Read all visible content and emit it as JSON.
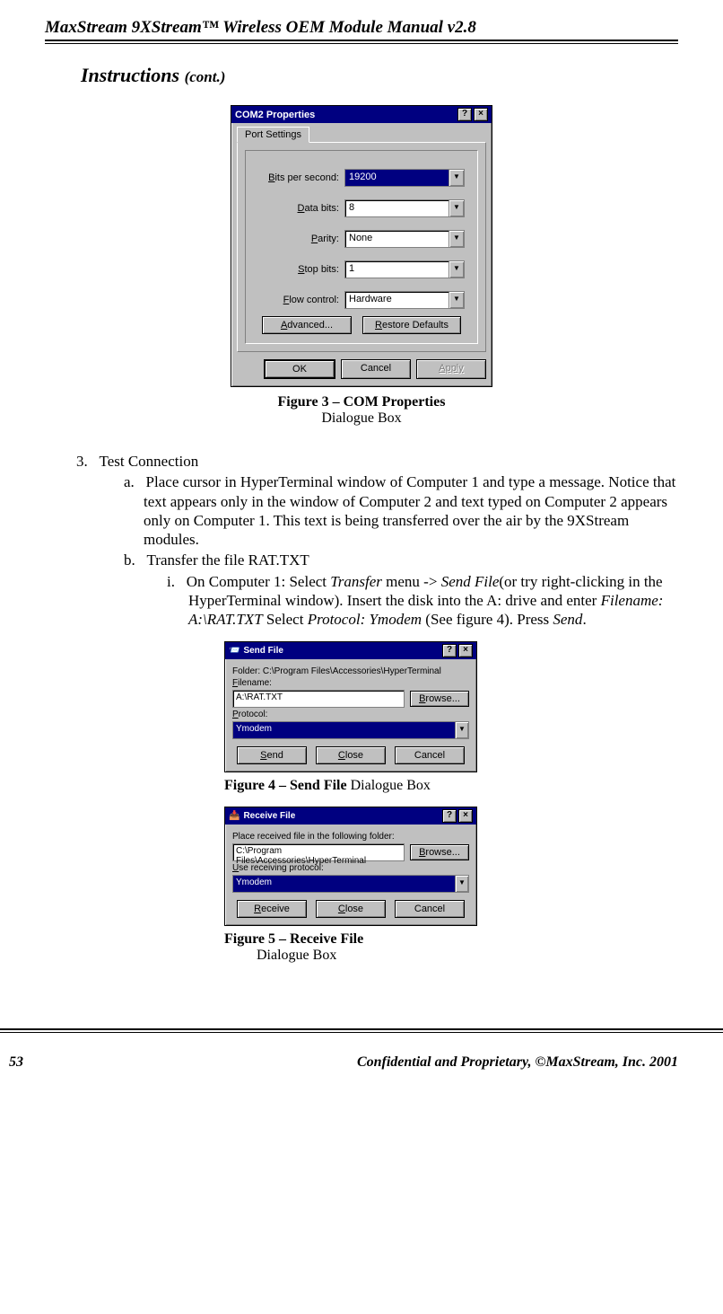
{
  "header": {
    "doc_title": "MaxStream 9XStream™ Wireless OEM Module Manual v2.8"
  },
  "section": {
    "heading_main": "Instructions ",
    "heading_cont": "(cont.)"
  },
  "com_dialog": {
    "title": "COM2 Properties",
    "help_btn": "?",
    "close_btn": "×",
    "tab": "Port Settings",
    "rows": {
      "bps_label": "Bits per second:",
      "bps_value": "19200",
      "databits_label": "Data bits:",
      "databits_value": "8",
      "parity_label": "Parity:",
      "parity_value": "None",
      "stopbits_label": "Stop bits:",
      "stopbits_value": "1",
      "flow_label": "Flow control:",
      "flow_value": "Hardware"
    },
    "advanced_btn": "Advanced...",
    "restore_btn": "Restore Defaults",
    "ok_btn": "OK",
    "cancel_btn": "Cancel",
    "apply_btn": "Apply"
  },
  "fig3": {
    "bold": "Figure 3 – COM Properties",
    "rest": " Dialogue Box"
  },
  "list": {
    "n3": "3.",
    "n3_text": "Test Connection",
    "a": "a.",
    "a_text": "Place cursor in HyperTerminal window of Computer 1 and type a message. Notice that text appears only in the window of Computer 2 and text typed on Computer 2 appears only on Computer 1. This text is being transferred over the air by the 9XStream modules.",
    "b": "b.",
    "b_text": "Transfer the file RAT.TXT",
    "i": "i.",
    "i_pre": "On Computer 1: Select ",
    "i_transfer": "Transfer",
    "i_mid1": " menu -> ",
    "i_sendfile": "Send File",
    "i_mid2": "(or try right-clicking in the HyperTerminal window). Insert the disk into the A: drive and enter ",
    "i_filename": "Filename: A:\\RAT.TXT",
    "i_mid3": "  Select ",
    "i_protocol": "Protocol: Ymodem",
    "i_mid4": " (See figure 4). Press ",
    "i_send": "Send",
    "i_end": "."
  },
  "send_dialog": {
    "title": "Send File",
    "help_btn": "?",
    "close_btn": "×",
    "folder_label": "Folder:  C:\\Program Files\\Accessories\\HyperTerminal",
    "filename_label": "Filename:",
    "filename_value": "A:\\RAT.TXT",
    "browse_btn": "Browse...",
    "protocol_label": "Protocol:",
    "protocol_value": "Ymodem",
    "send_btn": "Send",
    "close_btn2": "Close",
    "cancel_btn": "Cancel"
  },
  "fig4": {
    "bold": "Figure 4 – Send File",
    "rest": " Dialogue Box"
  },
  "recv_dialog": {
    "title": "Receive File",
    "help_btn": "?",
    "close_btn": "×",
    "place_label": "Place received file in the following folder:",
    "folder_value": "C:\\Program Files\\Accessories\\HyperTerminal",
    "browse_btn": "Browse...",
    "use_label": "Use receiving protocol:",
    "protocol_value": "Ymodem",
    "receive_btn": "Receive",
    "close_btn2": "Close",
    "cancel_btn": "Cancel"
  },
  "fig5": {
    "bold": "Figure 5    – Receive File",
    "rest": " Dialogue Box"
  },
  "footer": {
    "page": "53",
    "text": "Confidential and Proprietary, ©MaxStream, Inc. 2001"
  }
}
